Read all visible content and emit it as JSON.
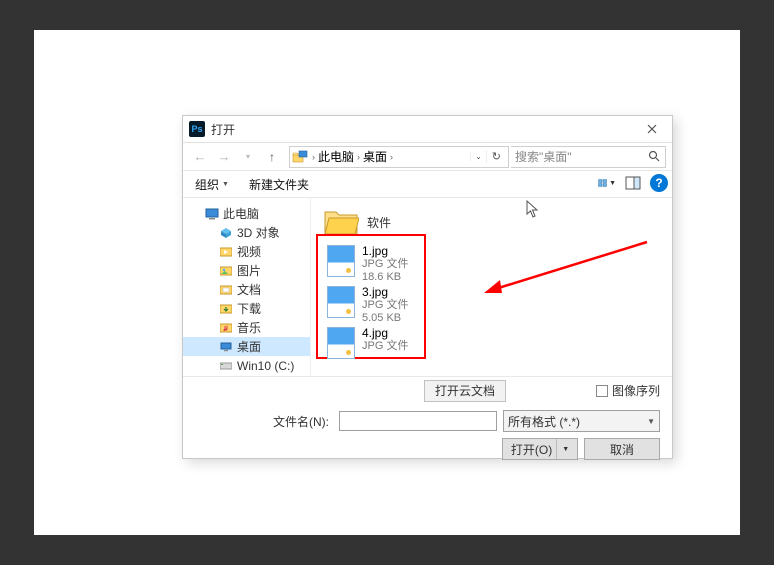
{
  "title": "打开",
  "nav": {
    "back": "←",
    "forward": "→",
    "up": "↑"
  },
  "breadcrumb": {
    "root": "此电脑",
    "folder": "桌面"
  },
  "search": {
    "placeholder": "搜索\"桌面\""
  },
  "cmdbar": {
    "organize": "组织",
    "newfolder": "新建文件夹"
  },
  "sidebar": {
    "items": [
      {
        "label": "此电脑",
        "level": 1,
        "kind": "pc"
      },
      {
        "label": "3D 对象",
        "level": 2,
        "kind": "3d"
      },
      {
        "label": "视频",
        "level": 2,
        "kind": "video"
      },
      {
        "label": "图片",
        "level": 2,
        "kind": "pictures"
      },
      {
        "label": "文档",
        "level": 2,
        "kind": "docs"
      },
      {
        "label": "下载",
        "level": 2,
        "kind": "downloads"
      },
      {
        "label": "音乐",
        "level": 2,
        "kind": "music"
      },
      {
        "label": "桌面",
        "level": 2,
        "kind": "desktop",
        "selected": true
      },
      {
        "label": "Win10 (C:)",
        "level": 2,
        "kind": "drive"
      }
    ]
  },
  "files": {
    "folder": {
      "name": "软件"
    },
    "items": [
      {
        "name": "1.jpg",
        "type": "JPG 文件",
        "size": "18.6 KB"
      },
      {
        "name": "3.jpg",
        "type": "JPG 文件",
        "size": "5.05 KB"
      },
      {
        "name": "4.jpg",
        "type": "JPG 文件",
        "size": ""
      }
    ]
  },
  "cloud_btn": "打开云文档",
  "image_sequence": "图像序列",
  "filename_label": "文件名(N):",
  "filter": "所有格式 (*.*)",
  "open_btn": "打开(O)",
  "cancel_btn": "取消",
  "help": "?"
}
